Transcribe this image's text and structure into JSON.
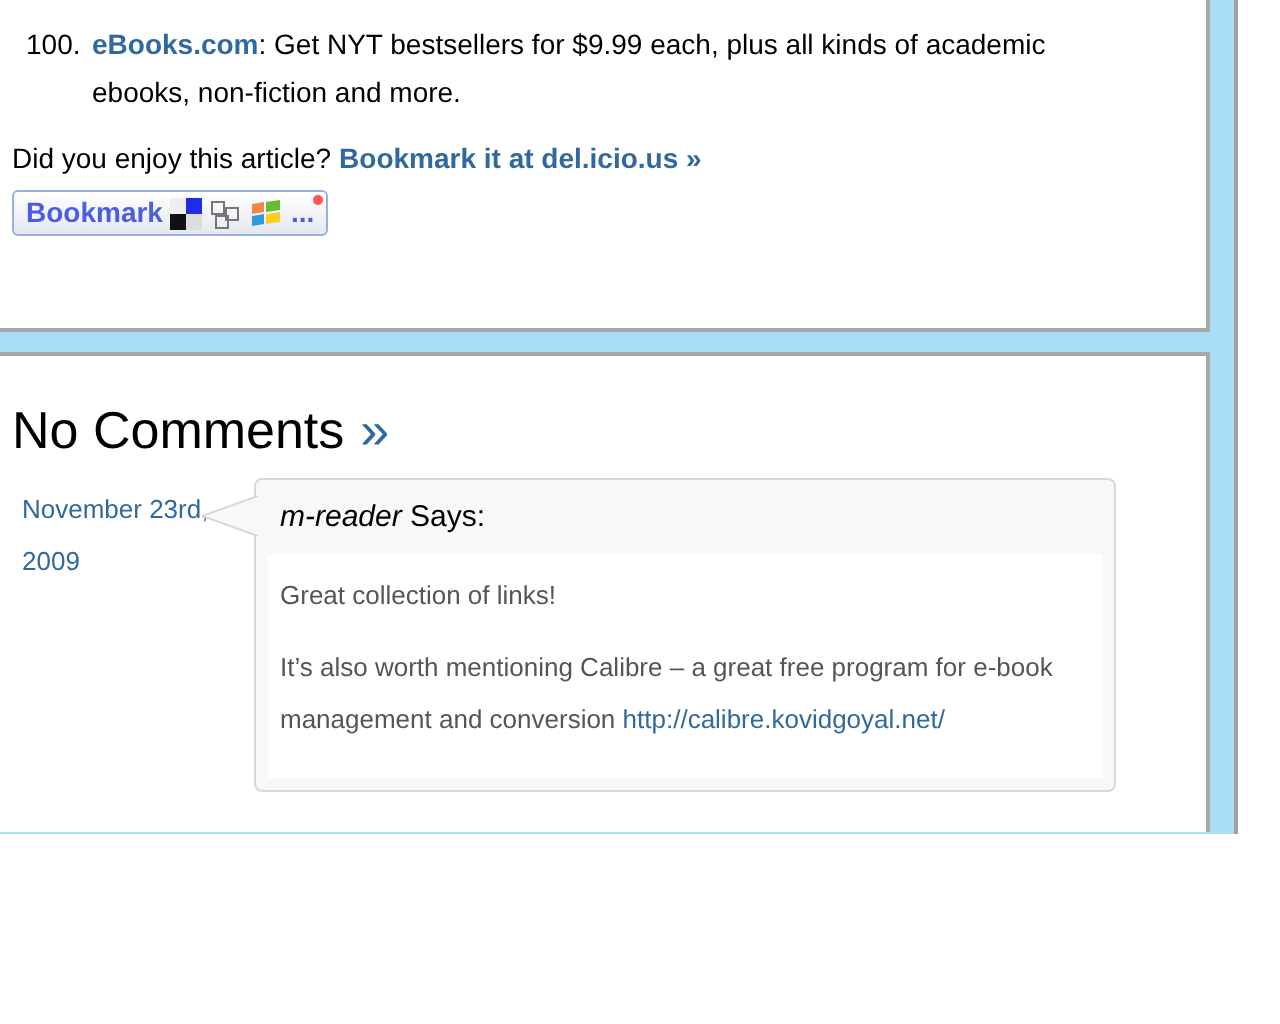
{
  "list_item": {
    "number": "100.",
    "link": "eBooks.com",
    "text": ": Get NYT bestsellers for $9.99 each, plus all kinds of academic ebooks, non-fiction and more."
  },
  "bookmark_prompt": {
    "text": "Did you enjoy this article?",
    "link": "Bookmark it at del.icio.us »"
  },
  "bookmark_button": {
    "label": "Bookmark",
    "more": "..."
  },
  "comments": {
    "title": "No Comments",
    "arrow": "»",
    "items": [
      {
        "date": "November 23rd, 2009",
        "author": "m-reader",
        "says": "Says:",
        "paragraphs": [
          "Great collection of links!",
          "It’s also worth mentioning Calibre – a great free program for e-book management and conversion"
        ],
        "link": "http://calibre.kovidgoyal.net/"
      }
    ]
  }
}
